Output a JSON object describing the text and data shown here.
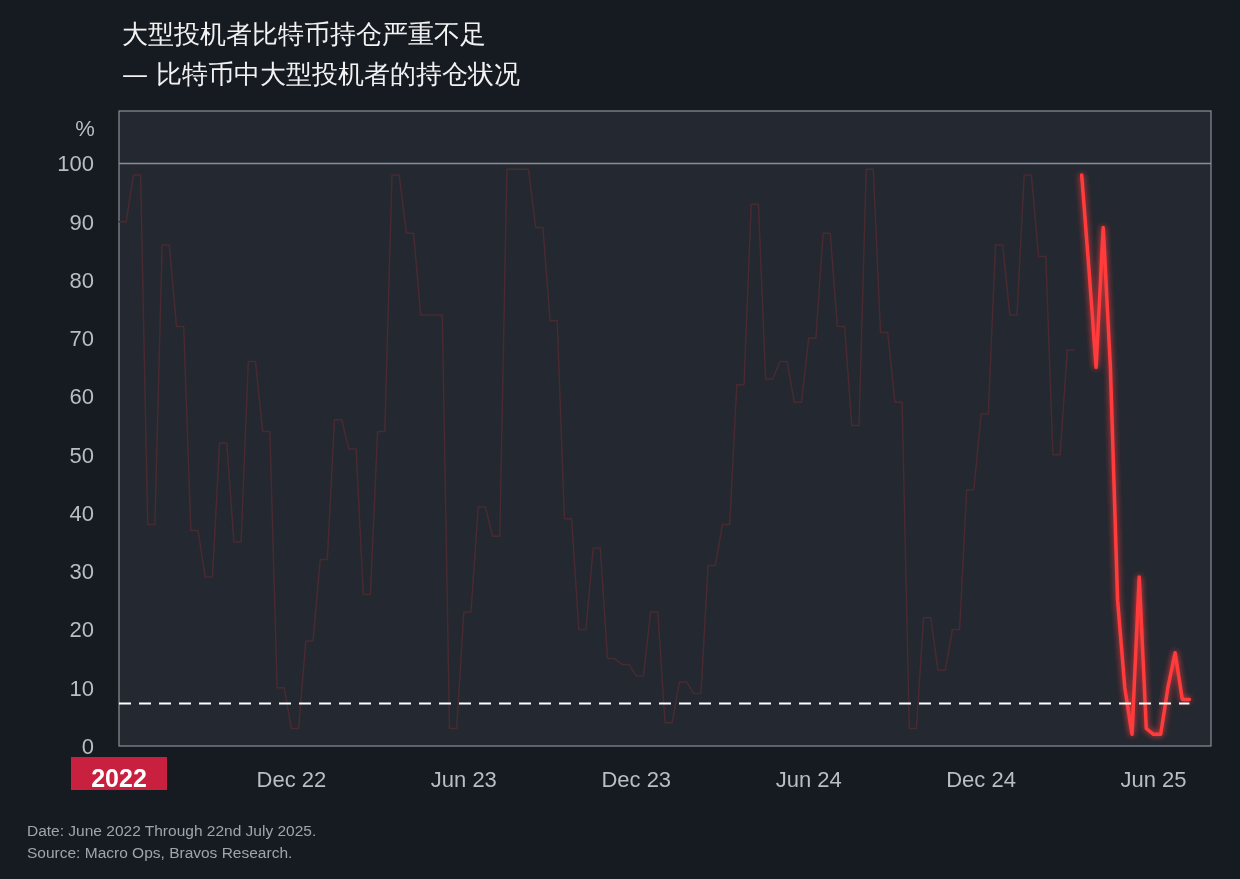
{
  "title": "大型投机者比特币持仓严重不足",
  "subtitle": "—  比特币中大型投机者的持仓状况",
  "chart": {
    "chart_data": {
      "type": "line",
      "ylabel": "%",
      "ylim": [
        0,
        109
      ],
      "yticks": [
        0,
        10,
        20,
        30,
        40,
        50,
        60,
        70,
        80,
        90,
        100
      ],
      "categories": [
        "2022",
        null,
        null,
        null,
        null,
        null,
        null,
        null,
        null,
        null,
        null,
        null,
        null,
        null,
        null,
        null,
        null,
        null,
        null,
        null,
        null,
        null,
        null,
        null,
        "Dec 22",
        null,
        null,
        null,
        null,
        null,
        null,
        null,
        null,
        null,
        null,
        null,
        null,
        null,
        null,
        null,
        null,
        null,
        null,
        null,
        null,
        null,
        null,
        null,
        "Jun 23",
        null,
        null,
        null,
        null,
        null,
        null,
        null,
        null,
        null,
        null,
        null,
        null,
        null,
        null,
        null,
        null,
        null,
        null,
        null,
        null,
        null,
        null,
        null,
        "Dec 23",
        null,
        null,
        null,
        null,
        null,
        null,
        null,
        null,
        null,
        null,
        null,
        null,
        null,
        null,
        null,
        null,
        null,
        null,
        null,
        null,
        null,
        null,
        null,
        "Jun 24",
        null,
        null,
        null,
        null,
        null,
        null,
        null,
        null,
        null,
        null,
        null,
        null,
        null,
        null,
        null,
        null,
        null,
        null,
        null,
        null,
        null,
        null,
        null,
        "Dec 24",
        null,
        null,
        null,
        null,
        null,
        null,
        null,
        null,
        null,
        null,
        null,
        null,
        null,
        null,
        null,
        null,
        null,
        null,
        null,
        null,
        null,
        null,
        null,
        "Jun 25",
        null,
        null,
        null,
        null,
        null
      ],
      "series": [
        {
          "color": "#4a2a31",
          "values": [
            90,
            90,
            98,
            98,
            38,
            38,
            86,
            86,
            72,
            72,
            37,
            37,
            29,
            29,
            52,
            52,
            35,
            35,
            66,
            66,
            54,
            54,
            10,
            10,
            3,
            3,
            18,
            18,
            32,
            32,
            56,
            56,
            51,
            51,
            26,
            26,
            54,
            54,
            98,
            98,
            88,
            88,
            74,
            74,
            74,
            74,
            3,
            3,
            23,
            23,
            41,
            41,
            36,
            36,
            99,
            99,
            99,
            99,
            89,
            89,
            73,
            73,
            39,
            39,
            20,
            20,
            34,
            34,
            15,
            15,
            14,
            14,
            12,
            12,
            23,
            23,
            4,
            4,
            11,
            11,
            9,
            9,
            31,
            31,
            38,
            38,
            62,
            62,
            93,
            93,
            63,
            63,
            66,
            66,
            59,
            59,
            70,
            70,
            88,
            88,
            72,
            72,
            55,
            55,
            99,
            99,
            71,
            71,
            59,
            59,
            3,
            3,
            22,
            22,
            13,
            13,
            20,
            20,
            44,
            44,
            57,
            57,
            86,
            86,
            74,
            74,
            98,
            98,
            84,
            84,
            50,
            50,
            68,
            68,
            null,
            null,
            null,
            null,
            null,
            null,
            null,
            null,
            null,
            null,
            null,
            null,
            null,
            null,
            null,
            null
          ]
        },
        {
          "color": "#ff3b3b",
          "values": [
            null,
            null,
            null,
            null,
            null,
            null,
            null,
            null,
            null,
            null,
            null,
            null,
            null,
            null,
            null,
            null,
            null,
            null,
            null,
            null,
            null,
            null,
            null,
            null,
            null,
            null,
            null,
            null,
            null,
            null,
            null,
            null,
            null,
            null,
            null,
            null,
            null,
            null,
            null,
            null,
            null,
            null,
            null,
            null,
            null,
            null,
            null,
            null,
            null,
            null,
            null,
            null,
            null,
            null,
            null,
            null,
            null,
            null,
            null,
            null,
            null,
            null,
            null,
            null,
            null,
            null,
            null,
            null,
            null,
            null,
            null,
            null,
            null,
            null,
            null,
            null,
            null,
            null,
            null,
            null,
            null,
            null,
            null,
            null,
            null,
            null,
            null,
            null,
            null,
            null,
            null,
            null,
            null,
            null,
            null,
            null,
            null,
            null,
            null,
            null,
            null,
            null,
            null,
            null,
            null,
            null,
            null,
            null,
            null,
            null,
            null,
            null,
            null,
            null,
            null,
            null,
            null,
            null,
            null,
            null,
            null,
            null,
            null,
            null,
            null,
            null,
            null,
            null,
            null,
            null,
            null,
            null,
            null,
            null,
            98,
            82,
            65,
            89,
            65,
            25,
            10,
            2,
            29,
            3,
            2,
            2,
            10,
            16,
            8,
            8
          ]
        },
        {
          "color": "#ffffff",
          "line_style": "dashed",
          "values": [
            7.3,
            7.3,
            7.3,
            7.3,
            7.3,
            7.3,
            7.3,
            7.3,
            7.3,
            7.3,
            7.3,
            7.3,
            7.3,
            7.3,
            7.3,
            7.3,
            7.3,
            7.3,
            7.3,
            7.3,
            7.3,
            7.3,
            7.3,
            7.3,
            7.3,
            7.3,
            7.3,
            7.3,
            7.3,
            7.3,
            7.3,
            7.3,
            7.3,
            7.3,
            7.3,
            7.3,
            7.3,
            7.3,
            7.3,
            7.3,
            7.3,
            7.3,
            7.3,
            7.3,
            7.3,
            7.3,
            7.3,
            7.3,
            7.3,
            7.3,
            7.3,
            7.3,
            7.3,
            7.3,
            7.3,
            7.3,
            7.3,
            7.3,
            7.3,
            7.3,
            7.3,
            7.3,
            7.3,
            7.3,
            7.3,
            7.3,
            7.3,
            7.3,
            7.3,
            7.3,
            7.3,
            7.3,
            7.3,
            7.3,
            7.3,
            7.3,
            7.3,
            7.3,
            7.3,
            7.3,
            7.3,
            7.3,
            7.3,
            7.3,
            7.3,
            7.3,
            7.3,
            7.3,
            7.3,
            7.3,
            7.3,
            7.3,
            7.3,
            7.3,
            7.3,
            7.3,
            7.3,
            7.3,
            7.3,
            7.3,
            7.3,
            7.3,
            7.3,
            7.3,
            7.3,
            7.3,
            7.3,
            7.3,
            7.3,
            7.3,
            7.3,
            7.3,
            7.3,
            7.3,
            7.3,
            7.3,
            7.3,
            7.3,
            7.3,
            7.3,
            7.3,
            7.3,
            7.3,
            7.3,
            7.3,
            7.3,
            7.3,
            7.3,
            7.3,
            7.3,
            7.3,
            7.3,
            7.3,
            7.3,
            7.3,
            7.3,
            7.3,
            7.3,
            7.3,
            7.3,
            7.3,
            7.3,
            7.3,
            7.3,
            7.3,
            7.3,
            7.3,
            7.3,
            7.3,
            7.3
          ]
        }
      ]
    },
    "first_label_highlighted": true
  },
  "notes": [
    "Date: June 2022 Through 22nd July 2025.",
    "Source: Macro Ops, Bravos Research."
  ]
}
